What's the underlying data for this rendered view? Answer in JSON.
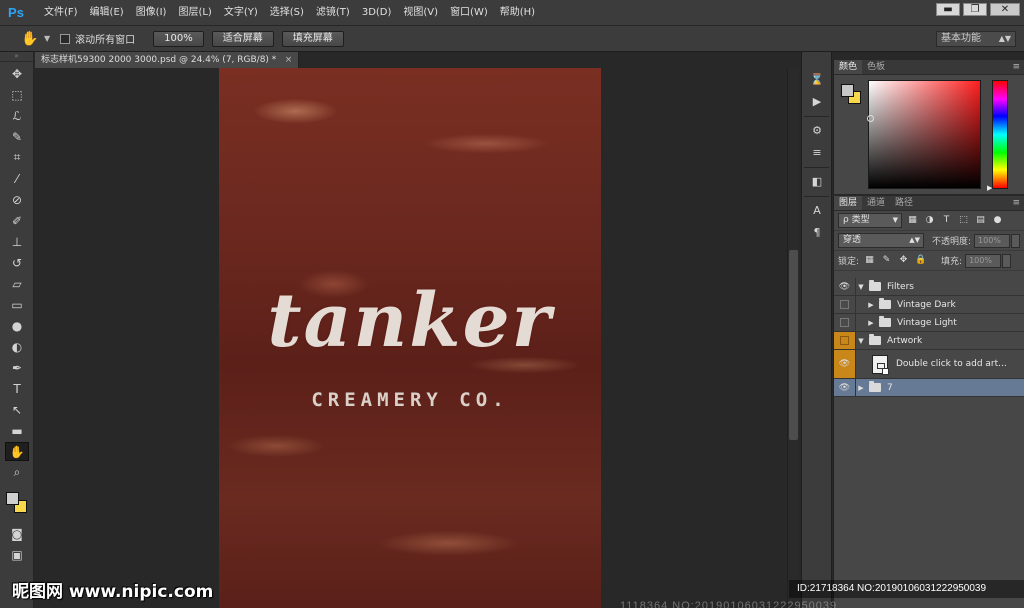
{
  "app": {
    "logo": "Ps"
  },
  "menu": [
    "文件(F)",
    "编辑(E)",
    "图像(I)",
    "图层(L)",
    "文字(Y)",
    "选择(S)",
    "滤镜(T)",
    "3D(D)",
    "视图(V)",
    "窗口(W)",
    "帮助(H)"
  ],
  "window_controls": {
    "minimize": "▬",
    "restore": "❐",
    "close": "✕"
  },
  "options_bar": {
    "scroll_all_label": "滚动所有窗口",
    "btn_100": "100%",
    "btn_fit": "适合屏幕",
    "btn_fill": "填充屏幕",
    "workspace": "基本功能"
  },
  "document": {
    "tab_title": "标志样机59300 2000 3000.psd @ 24.4% (7, RGB/8) *",
    "artwork_title": "tanker",
    "artwork_subtitle": "CREAMERY CO."
  },
  "color_panel": {
    "tabs": [
      "颜色",
      "色板"
    ],
    "foreground": "#cfcfcf",
    "background": "#f6d84a"
  },
  "layers_panel": {
    "tabs": [
      "图层",
      "通道",
      "路径"
    ],
    "filter_kind": "ρ 类型",
    "blend_mode": "穿透",
    "opacity_label": "不透明度:",
    "opacity_value": "100%",
    "lock_label": "锁定:",
    "fill_label": "填充:",
    "fill_value": "100%",
    "layers": [
      {
        "name": "Filters",
        "type": "group",
        "expanded": true,
        "visible": true
      },
      {
        "name": "Vintage Dark",
        "type": "group",
        "expanded": false,
        "visible": false
      },
      {
        "name": "Vintage Light",
        "type": "group",
        "expanded": false,
        "visible": false
      },
      {
        "name": "Artwork",
        "type": "group",
        "expanded": true,
        "visible": false
      },
      {
        "name": "Double click to add art...",
        "type": "smart-object",
        "visible": true
      },
      {
        "name": "7",
        "type": "group",
        "expanded": false,
        "visible": true,
        "selected": true
      }
    ]
  },
  "watermark": {
    "logo": "昵图网 www.nipic.com",
    "id_text": "ID:21718364 NO:20190106031222950039",
    "faint": "1118364 NO:20190106031222950039"
  },
  "colors": {
    "accent": "#667995",
    "orange": "#c98619",
    "ps_blue": "#2fa3f5"
  }
}
